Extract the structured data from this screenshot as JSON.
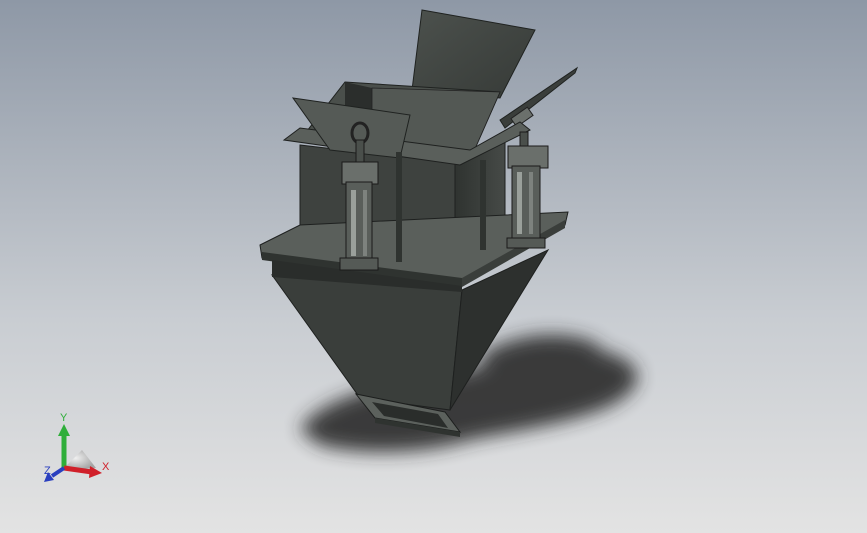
{
  "viewport": {
    "background_top": "#8e98a6",
    "background_bottom": "#e3e3e3",
    "part_color": "#3e423f",
    "part_dark": "#2a2d2b",
    "part_light": "#5a5f5b",
    "shadow_color": "#2b2b2b"
  },
  "triad": {
    "x_label": "X",
    "y_label": "Y",
    "z_label": "Z",
    "x_color": "#d0202a",
    "y_color": "#2fae3a",
    "z_color": "#2a3fbf"
  }
}
